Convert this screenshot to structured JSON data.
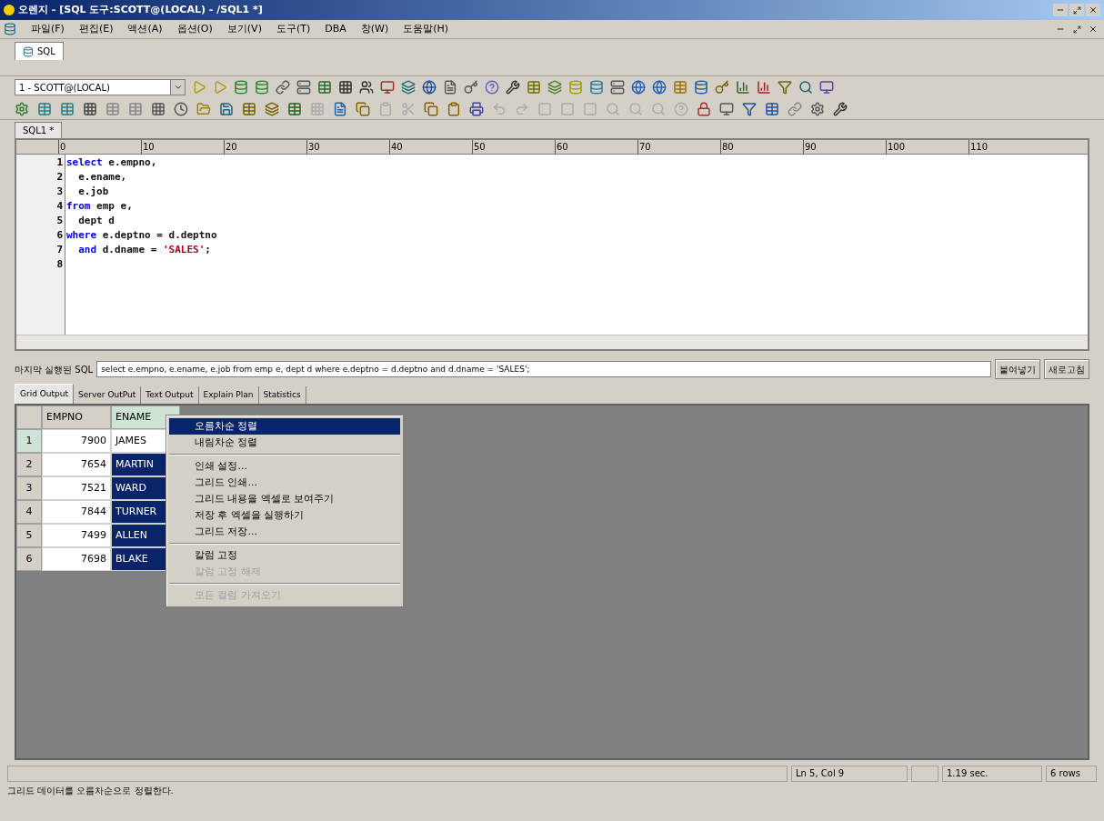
{
  "window": {
    "title": "오렌지 - [SQL 도구:SCOTT@(LOCAL) - /SQL1 *]"
  },
  "menu": [
    "파일(F)",
    "편집(E)",
    "액션(A)",
    "옵션(O)",
    "보기(V)",
    "도구(T)",
    "DBA",
    "창(W)",
    "도움말(H)"
  ],
  "doc_tabs": [
    {
      "label": "SQL",
      "selected": true
    }
  ],
  "connection": {
    "value": "1 - SCOTT@(LOCAL)"
  },
  "editor_tabs": [
    {
      "label": "SQL1 *",
      "selected": true
    }
  ],
  "ruler": [
    "0",
    "10",
    "20",
    "30",
    "40",
    "50",
    "60",
    "70",
    "80",
    "90",
    "100",
    "110"
  ],
  "code_lines": [
    {
      "number": "1",
      "tokens": [
        {
          "kind": "keyword",
          "text": "select"
        },
        {
          "kind": "plain",
          "text": " e.empno,"
        }
      ]
    },
    {
      "number": "2",
      "tokens": [
        {
          "kind": "plain",
          "text": "  e.ename,"
        }
      ]
    },
    {
      "number": "3",
      "tokens": [
        {
          "kind": "plain",
          "text": "  e.job"
        }
      ]
    },
    {
      "number": "4",
      "tokens": [
        {
          "kind": "keyword",
          "text": "from"
        },
        {
          "kind": "plain",
          "text": " emp e,"
        }
      ]
    },
    {
      "number": "5",
      "tokens": [
        {
          "kind": "plain",
          "text": "  dept d"
        }
      ]
    },
    {
      "number": "6",
      "tokens": [
        {
          "kind": "keyword",
          "text": "where"
        },
        {
          "kind": "plain",
          "text": " e.deptno = d.deptno"
        }
      ]
    },
    {
      "number": "7",
      "tokens": [
        {
          "kind": "keyword",
          "text": "  and"
        },
        {
          "kind": "plain",
          "text": " d.dname = "
        },
        {
          "kind": "string",
          "text": "'SALES'"
        },
        {
          "kind": "plain",
          "text": ";"
        }
      ]
    },
    {
      "number": "8"
    }
  ],
  "last_sql": {
    "label": "마지막 실행된 SQL",
    "value": "select e.empno,   e.ename,   e.job from emp e,   dept d where e.deptno = d.deptno   and d.dname = 'SALES';",
    "buttons": [
      "붙여넣기",
      "새로고침"
    ]
  },
  "result_tabs": [
    {
      "label": "Grid Output",
      "selected": true
    },
    {
      "label": "Server OutPut",
      "selected": false
    },
    {
      "label": "Text Output",
      "selected": false
    },
    {
      "label": "Explain Plan",
      "selected": false
    },
    {
      "label": "Statistics",
      "selected": false
    }
  ],
  "grid": {
    "columns": [
      "EMPNO",
      "ENAME"
    ],
    "rows": [
      {
        "number": "1",
        "empno": "7900",
        "ename": "JAMES",
        "selected": false
      },
      {
        "number": "2",
        "empno": "7654",
        "ename": "MARTIN",
        "selected": true
      },
      {
        "number": "3",
        "empno": "7521",
        "ename": "WARD",
        "selected": true
      },
      {
        "number": "4",
        "empno": "7844",
        "ename": "TURNER",
        "selected": true
      },
      {
        "number": "5",
        "empno": "7499",
        "ename": "ALLEN",
        "selected": true
      },
      {
        "number": "6",
        "empno": "7698",
        "ename": "BLAKE",
        "selected": true
      }
    ]
  },
  "context_menu": [
    {
      "kind": "item",
      "label": "오름차순 정렬",
      "selected": true,
      "disabled": false
    },
    {
      "kind": "item",
      "label": "내림차순 정렬",
      "selected": false,
      "disabled": false
    },
    {
      "kind": "separator"
    },
    {
      "kind": "item",
      "label": "인쇄 설정...",
      "selected": false,
      "disabled": false
    },
    {
      "kind": "item",
      "label": "그리드 인쇄...",
      "selected": false,
      "disabled": false
    },
    {
      "kind": "item",
      "label": "그리드 내용을 엑셀로 보여주기",
      "selected": false,
      "disabled": false
    },
    {
      "kind": "item",
      "label": "저장 후 엑셀을 실행하기",
      "selected": false,
      "disabled": false
    },
    {
      "kind": "item",
      "label": "그리드 저장...",
      "selected": false,
      "disabled": false
    },
    {
      "kind": "separator"
    },
    {
      "kind": "item",
      "label": "칼럼 고정",
      "selected": false,
      "disabled": false
    },
    {
      "kind": "item",
      "label": "칼럼 고정 해제",
      "selected": false,
      "disabled": true
    },
    {
      "kind": "separator"
    },
    {
      "kind": "item",
      "label": "모든 컬럼 가져오기",
      "selected": false,
      "disabled": true
    }
  ],
  "status_bar": {
    "position": "Ln 5, Col 9",
    "time": "1.19 sec.",
    "rows": "6 rows",
    "message": "그리드 데이터를 오름차순으로 정렬한다."
  }
}
